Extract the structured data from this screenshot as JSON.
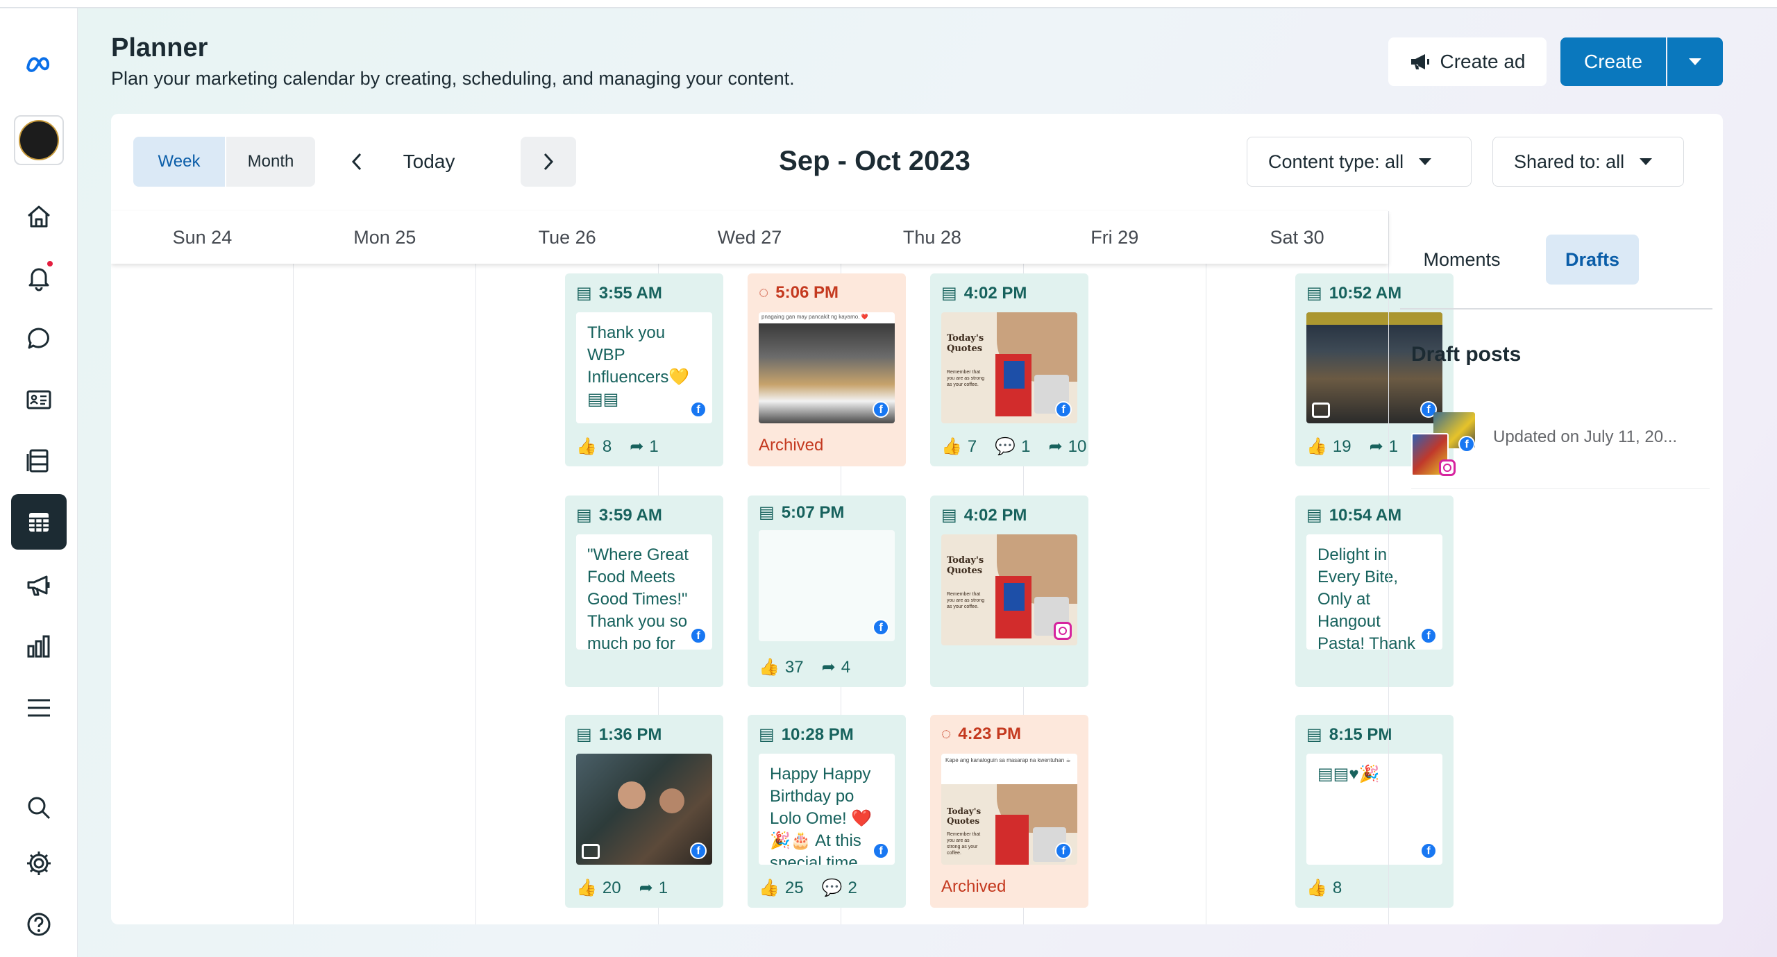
{
  "header": {
    "title": "Planner",
    "subtitle": "Plan your marketing calendar by creating, scheduling, and managing your content.",
    "create_ad_label": "Create ad",
    "create_label": "Create"
  },
  "toolbar": {
    "week_label": "Week",
    "month_label": "Month",
    "today_label": "Today",
    "date_range": "Sep - Oct 2023",
    "content_filter": "Content type: all",
    "shared_filter": "Shared to: all"
  },
  "days": [
    "Sun 24",
    "Mon 25",
    "Tue 26",
    "Wed 27",
    "Thu 28",
    "Fri 29",
    "Sat 30"
  ],
  "posts": [
    {
      "time": "3:55 AM",
      "text": "Thank you WBP Influencers💛 ▤▤",
      "likes": "8",
      "shares": "1"
    },
    {
      "time": "3:59 AM",
      "text": "\"Where Great Food Meets Good Times!\" Thank you so much po for"
    },
    {
      "time": "1:36 PM",
      "likes": "20",
      "shares": "1"
    },
    {
      "time": "5:06 PM",
      "status": "Archived",
      "caption": "pnagaing gan may pancakit ng kayamo. ❤️"
    },
    {
      "time": "5:07 PM",
      "likes": "37",
      "shares": "4"
    },
    {
      "time": "10:28 PM",
      "text": "Happy Happy Birthday po Lolo Ome! ❤️ 🎉🎂 At this special time",
      "likes": "25",
      "comments": "2"
    },
    {
      "time": "4:02 PM",
      "likes": "7",
      "comments": "1",
      "shares": "10"
    },
    {
      "time": "4:02 PM"
    },
    {
      "time": "4:23 PM",
      "status": "Archived",
      "caption": "Kape ang kanaloguin sa masarap na kwentuhan ☕"
    },
    {
      "time": "10:52 AM",
      "likes": "19",
      "shares": "1"
    },
    {
      "time": "10:54 AM",
      "text": "Delight in Every Bite, Only at Hangout Pasta! Thank"
    },
    {
      "time": "8:15 PM",
      "text": "▤▤♥🎉",
      "likes": "8"
    }
  ],
  "quote_card": {
    "title": "Today's Quotes",
    "body": "Remember that you are as strong as your coffee."
  },
  "right_panel": {
    "tab_moments": "Moments",
    "tab_drafts": "Drafts",
    "heading": "Draft posts",
    "draft_updated": "Updated on July 11, 20..."
  },
  "colors": {
    "accent": "#0a78be",
    "post_green": "#e1f2ef",
    "post_orange": "#fde8dc",
    "teal_text": "#17625d",
    "archived": "#c4391f"
  }
}
